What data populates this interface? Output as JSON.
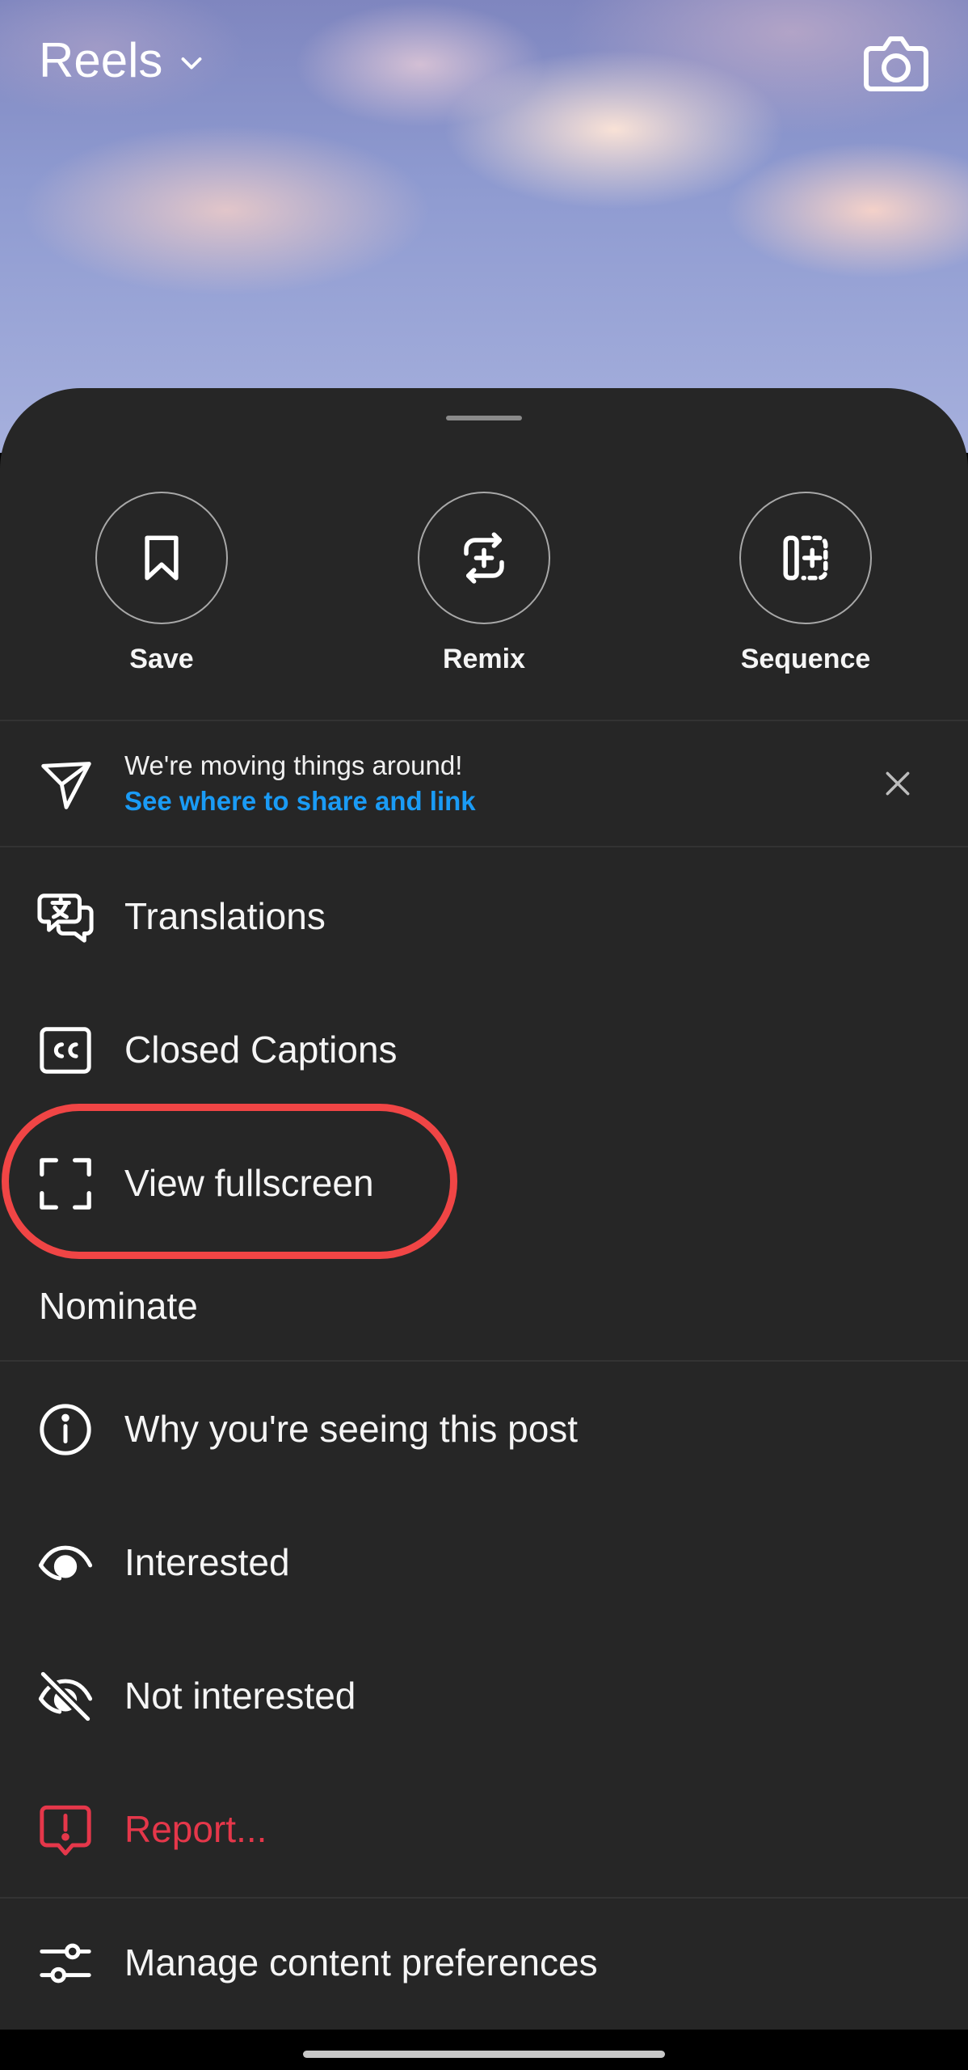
{
  "header": {
    "title": "Reels"
  },
  "actions": [
    {
      "label": "Save",
      "icon": "bookmark-icon"
    },
    {
      "label": "Remix",
      "icon": "remix-icon"
    },
    {
      "label": "Sequence",
      "icon": "sequence-icon"
    }
  ],
  "notice": {
    "message": "We're moving things around!",
    "link": "See where to share and link",
    "link_color": "#1a9bf5"
  },
  "menu": {
    "translations": "Translations",
    "closed_captions": "Closed Captions",
    "view_fullscreen": "View fullscreen",
    "nominate": "Nominate",
    "why_seeing": "Why you're seeing this post",
    "interested": "Interested",
    "not_interested": "Not interested",
    "report": "Report...",
    "manage_preferences": "Manage content preferences"
  },
  "colors": {
    "sheet_background": "#262626",
    "report_red": "#e5374a",
    "highlight_ring": "#f04545"
  }
}
